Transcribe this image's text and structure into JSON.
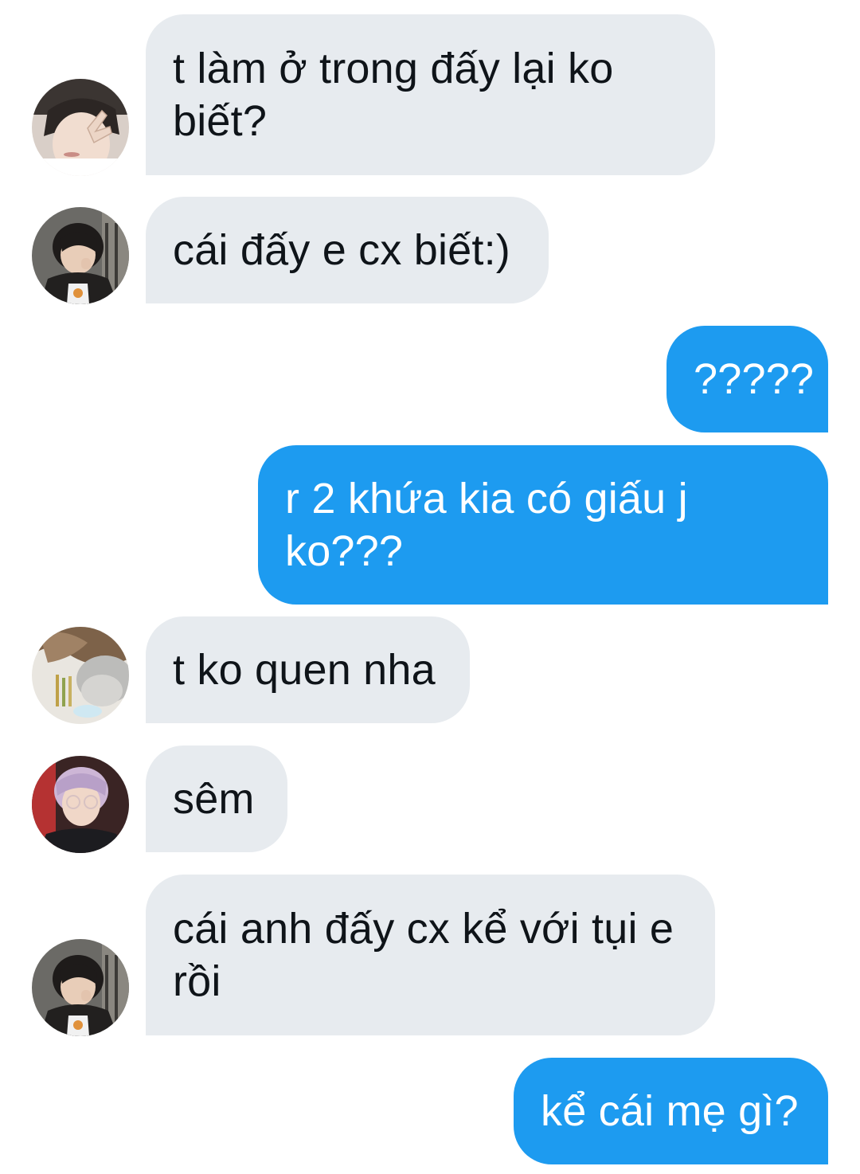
{
  "messages": [
    {
      "direction": "incoming",
      "avatar": "avatar-user-a-icon",
      "text": "t làm ở trong đấy lại ko biết?"
    },
    {
      "direction": "incoming",
      "avatar": "avatar-user-b-icon",
      "text": "cái đấy e cx biết:)"
    },
    {
      "direction": "outgoing",
      "text": "?????"
    },
    {
      "direction": "outgoing",
      "text": "r 2 khứa kia có giấu j ko???"
    },
    {
      "direction": "incoming",
      "avatar": "avatar-user-c-icon",
      "text": "t ko quen nha"
    },
    {
      "direction": "incoming",
      "avatar": "avatar-user-d-icon",
      "text": "sêm"
    },
    {
      "direction": "incoming",
      "avatar": "avatar-user-b-icon",
      "text": "cái anh đấy cx kể với tụi e rồi"
    },
    {
      "direction": "outgoing",
      "text": "kể cái mẹ gì?"
    }
  ],
  "colors": {
    "incoming_bubble": "#e7ebef",
    "incoming_text": "#0f1419",
    "outgoing_bubble": "#1d9bf0",
    "outgoing_text": "#ffffff",
    "background": "#ffffff"
  }
}
